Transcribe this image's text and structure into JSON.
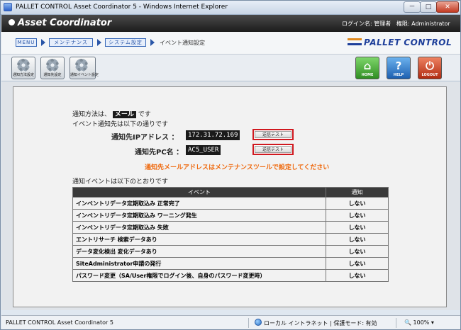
{
  "window": {
    "title": "PALLET CONTROL Asset Coordinator 5 - Windows Internet Explorer",
    "btn_min": "－",
    "btn_max": "□",
    "btn_close": "✕"
  },
  "header": {
    "app_name": "Asset Coordinator",
    "login_label": "ログイン名:",
    "login_name": "管理者",
    "auth_label": "権限:",
    "auth_value": "Administrator"
  },
  "breadcrumb": {
    "menu": "MENU",
    "maintenance": "メンテナンス",
    "system_settings": "システム設定",
    "current": "イベント通知設定",
    "brand": "PALLET CONTROL"
  },
  "toolbar": {
    "items": [
      {
        "label": "通知方法設定"
      },
      {
        "label": "通知先設定"
      },
      {
        "label": "通知イベント設定"
      }
    ],
    "home": "HOME",
    "help": "HELP",
    "logout": "LOGOUT",
    "help_symbol": "?",
    "home_symbol": "⌂",
    "logout_symbol": "⏻"
  },
  "form": {
    "method_prefix": "通知方法は、",
    "method_value": "メール",
    "method_suffix": "です",
    "dest_intro": "イベント通知先は以下の通りです",
    "ip_label": "通知先IPアドレス ：",
    "ip_value": "172.31.72.169",
    "pc_label": "通知先PC名 ：",
    "pc_value": "AC5_USER",
    "send_test": "送信テスト",
    "mail_note": "通知先メールアドレスはメンテナンスツールで設定してください",
    "events_intro": "通知イベントは以下のとおりです"
  },
  "events_table": {
    "headers": [
      "イベント",
      "通知"
    ],
    "rows": [
      {
        "event": "インベントリデータ定期取込み 正常完了",
        "notify": "しない"
      },
      {
        "event": "インベントリデータ定期取込み ワーニング発生",
        "notify": "しない"
      },
      {
        "event": "インベントリデータ定期取込み 失敗",
        "notify": "しない"
      },
      {
        "event": "エントリサーチ 検索データあり",
        "notify": "しない"
      },
      {
        "event": "データ変化検出 変化データあり",
        "notify": "しない"
      },
      {
        "event": "SiteAdministrator申請の発行",
        "notify": "しない"
      },
      {
        "event": "パスワード変更（SA/User権限でログイン後、自身のパスワード変更時）",
        "notify": "しない"
      }
    ]
  },
  "statusbar": {
    "left": "PALLET CONTROL Asset Coordinator 5",
    "zone": "ローカル イントラネット | 保護モード: 有効",
    "zoom": "100%"
  }
}
